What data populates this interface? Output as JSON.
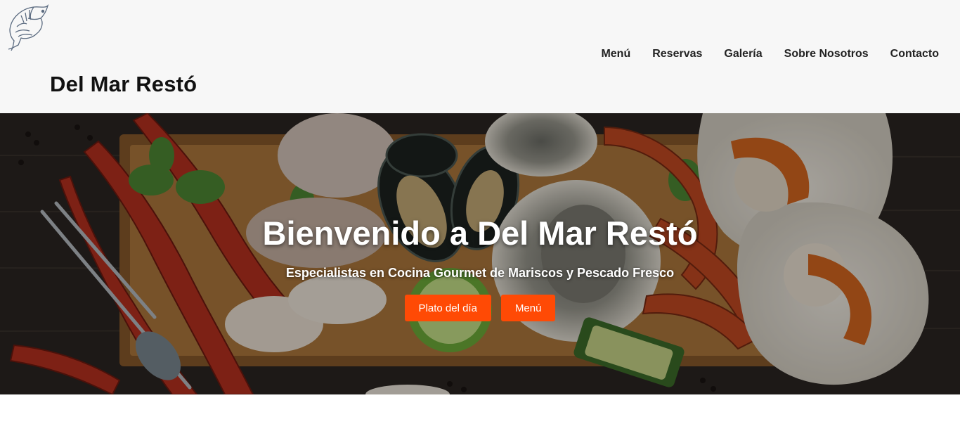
{
  "site": {
    "brand": "Del Mar Restó",
    "logo_icon": "fish-logo-icon"
  },
  "nav": {
    "items": [
      {
        "label": "Menú"
      },
      {
        "label": "Reservas"
      },
      {
        "label": "Galería"
      },
      {
        "label": "Sobre Nosotros"
      },
      {
        "label": "Contacto"
      }
    ]
  },
  "hero": {
    "title": "Bienvenido a Del Mar Restó",
    "subtitle": "Especialistas en Cocina Gourmet de Mariscos y Pescado Fresco",
    "buttons": [
      {
        "label": "Plato del día"
      },
      {
        "label": "Menú"
      }
    ],
    "background_image": "seafood-platter-photo"
  },
  "colors": {
    "accent": "#ff4a05",
    "header_bg": "#f7f7f7",
    "text_dark": "#111111"
  }
}
